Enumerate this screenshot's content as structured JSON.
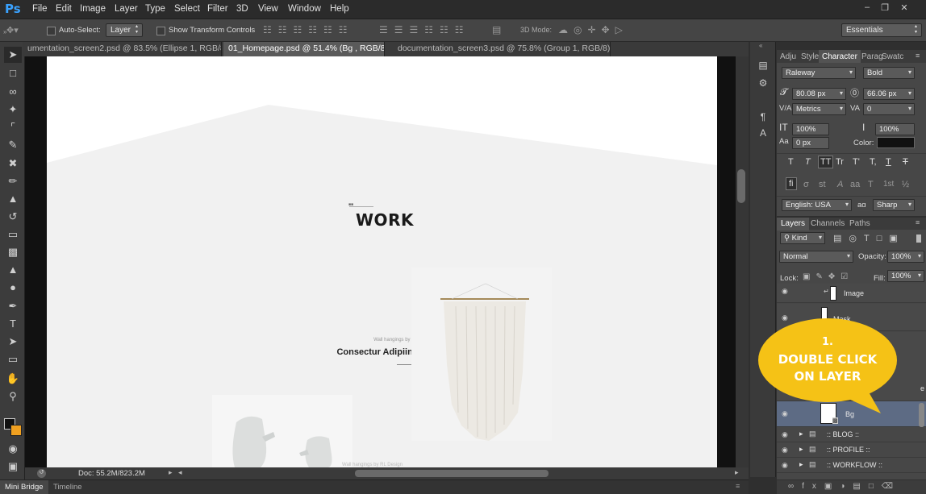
{
  "app": {
    "logo": "Ps"
  },
  "menu": [
    "File",
    "Edit",
    "Image",
    "Layer",
    "Type",
    "Select",
    "Filter",
    "3D",
    "View",
    "Window",
    "Help"
  ],
  "window_controls": {
    "minimize": "–",
    "restore": "❐",
    "close": "✕"
  },
  "options": {
    "auto_select_label": "Auto-Select:",
    "auto_select_value": "Layer",
    "transform_label": "Show Transform Controls",
    "mode_3d": "3D Mode:",
    "workspace": "Essentials"
  },
  "tabs": [
    {
      "label": "umentation_screen2.psd @ 83.5% (Ellipse 1, RGB/8) *"
    },
    {
      "label": "01_Homepage.psd @ 51.4% (Bg , RGB/8) *"
    },
    {
      "label": "documentation_screen3.psd @ 75.8% (Group 1, RGB/8) *"
    }
  ],
  "tab_close": "×",
  "document": {
    "section_title": "WORK",
    "caption": "Wall hangings by RL Design",
    "heading": "Consectur Adipiing",
    "bottom_caption": "Wall hangings by RL Design"
  },
  "status": {
    "doc": "Doc: 55.2M/823.2M"
  },
  "bottom": {
    "mini_bridge": "Mini Bridge",
    "timeline": "Timeline"
  },
  "character_panel": {
    "tabs": [
      "Adju",
      "Style",
      "Character",
      "Parag",
      "Swatc"
    ],
    "font_family": "Raleway",
    "font_style": "Bold",
    "size": "80.08 px",
    "leading": "66.06 px",
    "kerning": "Metrics",
    "tracking": "0",
    "vscale": "100%",
    "hscale": "100%",
    "baseline": "0 px",
    "color_label": "Color:",
    "language": "English: USA",
    "aa_prefix": "aɑ",
    "antialias": "Sharp",
    "style_buttons": [
      "T",
      "T",
      "TT",
      "Tr",
      "T'",
      "T,",
      "T",
      "T"
    ],
    "glyph_buttons": [
      "fi",
      "σ",
      "st",
      "A",
      "aa",
      "T",
      "1st",
      "½"
    ]
  },
  "layers_panel": {
    "tabs": [
      "Layers",
      "Channels",
      "Paths"
    ],
    "filter": "Kind",
    "blend": "Normal",
    "opacity_label": "Opacity:",
    "opacity": "100%",
    "lock_label": "Lock:",
    "fill_label": "Fill:",
    "fill": "100%",
    "layers": [
      {
        "name": "Image"
      },
      {
        "name": "Mask"
      },
      {
        "name": "Bg"
      },
      {
        "name": ":: BLOG ::"
      },
      {
        "name": ":: PROFILE ::"
      },
      {
        "name": ":: WORKFLOW ::"
      }
    ],
    "partial_e": "e"
  },
  "callout": {
    "step": "1.",
    "line1": "DOUBLE CLICK",
    "line2": "ON LAYER",
    "color": "#f5c216"
  }
}
